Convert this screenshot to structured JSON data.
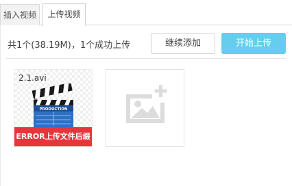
{
  "tabs": [
    {
      "label": "插入视频",
      "active": false
    },
    {
      "label": "上传视频",
      "active": true
    }
  ],
  "toolbar": {
    "status_text": "共1个(38.19M)，1个成功上传",
    "continue_label": "继续添加",
    "start_label": "开始上传"
  },
  "files": [
    {
      "name": "2.1.avi",
      "thumbnail_icon": "clapperboard-icon",
      "thumbnail_text": "PRODUCTION",
      "error_text": "ERROR上传文件后缀"
    }
  ],
  "add_tile": {
    "icon": "add-image-icon"
  },
  "colors": {
    "accent": "#66cdee",
    "error": "#e8353b",
    "placeholder_icon": "#dcdcdc"
  }
}
